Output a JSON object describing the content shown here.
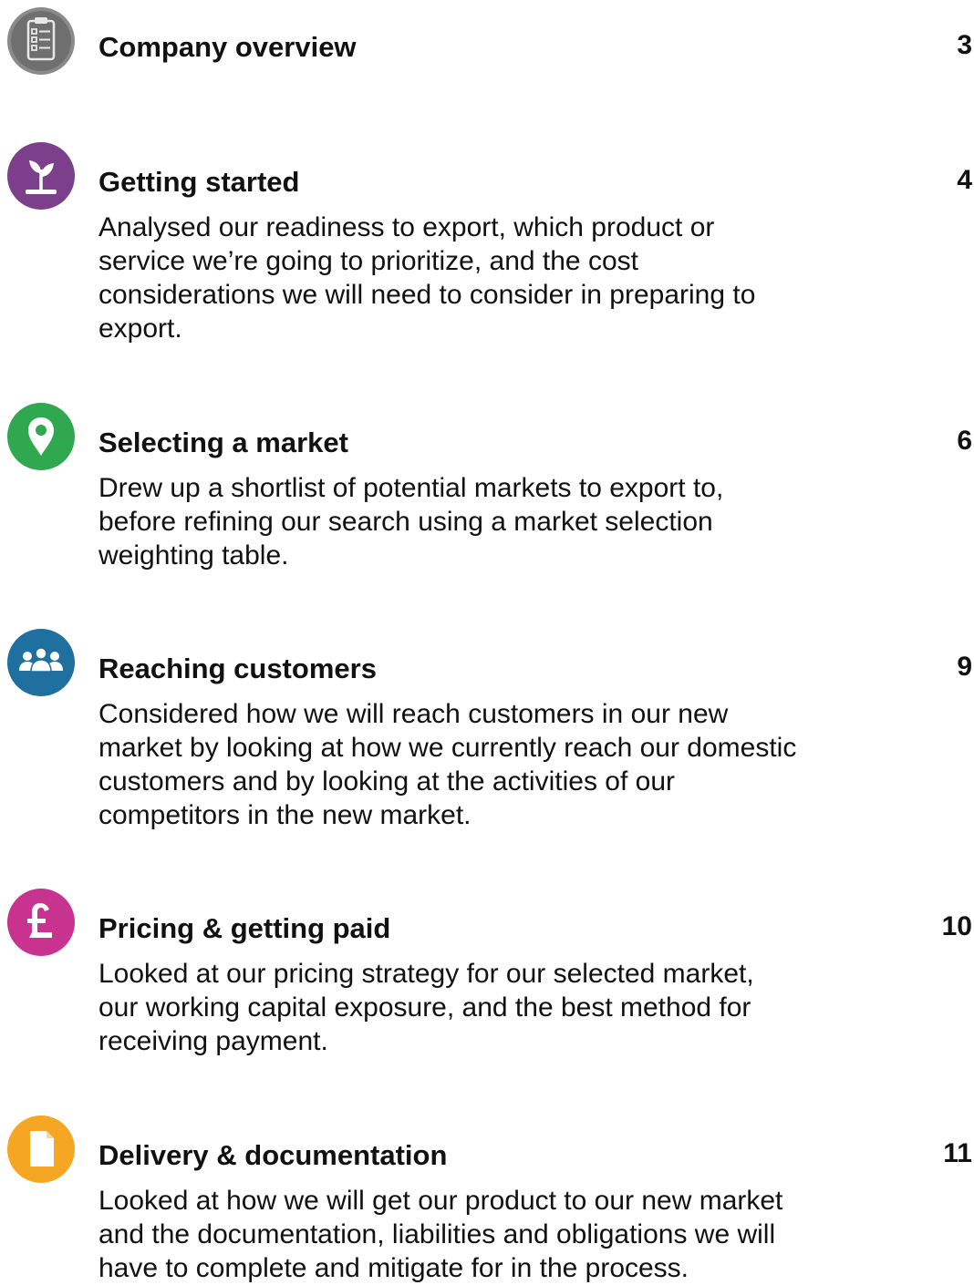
{
  "entries": [
    {
      "title": "Company overview",
      "page": "3",
      "icon": "clipboard-list-icon",
      "color": "#8a8a8a",
      "lines": []
    },
    {
      "title": "Getting started",
      "page": "4",
      "icon": "seedling-icon",
      "color": "#7b3f8c",
      "lines": [
        "Analysed our readiness to export, which product or",
        "service we’re going to prioritize, and the cost",
        "considerations we will need to consider in preparing to",
        "export."
      ]
    },
    {
      "title": "Selecting a market",
      "page": "6",
      "icon": "map-pin-icon",
      "color": "#2fa84f",
      "lines": [
        "Drew up a shortlist of potential markets to export to,",
        "before refining our search using a market selection",
        "weighting table."
      ]
    },
    {
      "title": "Reaching customers",
      "page": "9",
      "icon": "people-group-icon",
      "color": "#1f6f9f",
      "lines": [
        "Considered how we will reach customers in our new",
        "market by looking at how we currently reach our domestic",
        "customers and by looking at the activities of our",
        "competitors in the new market."
      ]
    },
    {
      "title": "Pricing & getting paid",
      "page": "10",
      "icon": "pound-sign-icon",
      "color": "#c7338f",
      "lines": [
        "Looked at our pricing strategy for our selected market,",
        "our working capital exposure, and the best method for",
        "receiving payment."
      ]
    },
    {
      "title": "Delivery & documentation",
      "page": "11",
      "icon": "document-icon",
      "color": "#f5a623",
      "lines": [
        "Looked at how we will get our product to our new market",
        "and the documentation, liabilities and obligations we will",
        "have to complete and mitigate for in the process."
      ]
    }
  ]
}
